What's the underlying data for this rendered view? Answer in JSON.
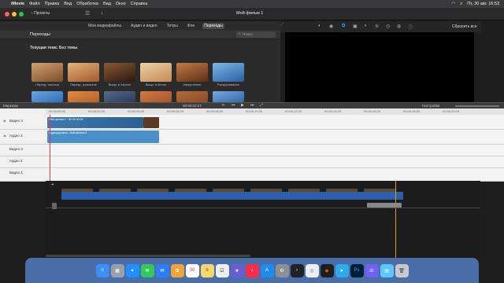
{
  "menubar": {
    "app": "iMovie",
    "items": [
      "Файл",
      "Правка",
      "Вид",
      "Обработка",
      "Вид",
      "Окно",
      "Справка"
    ],
    "clock": "Пт, 30 авг.  16:53"
  },
  "toolbar": {
    "projects_label": "Проекты",
    "title": "Мой фильм 1",
    "reset_label": "Сбросить все"
  },
  "tabs": [
    "Мои медиафайлы",
    "Аудио и видео",
    "Титры",
    "Фон",
    "Переходы"
  ],
  "library": {
    "heading": "Переходы",
    "search_placeholder": "Поиск",
    "theme_label": "Текущая тема: Без темы"
  },
  "transitions": [
    {
      "label": "Перекр. наплыв",
      "color": "#7b4e2b"
    },
    {
      "label": "Перекр. размытие",
      "color": "#a05a2c"
    },
    {
      "label": "Выцв. в черное",
      "color": "#4a2c1a"
    },
    {
      "label": "Выцв. в белое",
      "color": "#c28a54"
    },
    {
      "label": "Закругление",
      "color": "#8d5432"
    },
    {
      "label": "Раскручивание",
      "color": "#3b7fc4"
    }
  ],
  "transitions_row2": [
    "#2f6fba",
    "#b4622a",
    "#2a3d5a",
    "#a8552c",
    "#8a4b2a",
    "#3568a8"
  ],
  "timeline": {
    "left_label": "Маркеры",
    "current_time": "00:00:02:07",
    "ruler_ticks": [
      "00:00:00:00",
      "00:00:02:29",
      "00:00:04:29",
      "00:00:06:29",
      "00:00:08:29",
      "00:00:10:29",
      "00:00:12:29",
      "00:00:14:29",
      "00:00:16:29",
      "00:00:18:29",
      "00:00:20:29"
    ],
    "tracks": [
      "Видео 3",
      "Аудио 3",
      "Видео 2",
      "Аудио 2",
      "Видео 1"
    ],
    "right_label": "Настройки",
    "clip_label": "Мой фильм 1 - 00:00:00:00",
    "audio_label": "Аудиодорожка - Мой фильм 1"
  },
  "dock": [
    "Finder",
    "Launchpad",
    "Safari",
    "Messages",
    "Mail",
    "Photos",
    "Calendar",
    "Notes",
    "Reminders",
    "iMovie",
    "Music",
    "App Store",
    "Settings",
    "Terminal",
    "Chrome",
    "Figma",
    "Telegram",
    "Photoshop",
    "Viber",
    "Preview",
    "Trash"
  ],
  "calendar_day": "30"
}
